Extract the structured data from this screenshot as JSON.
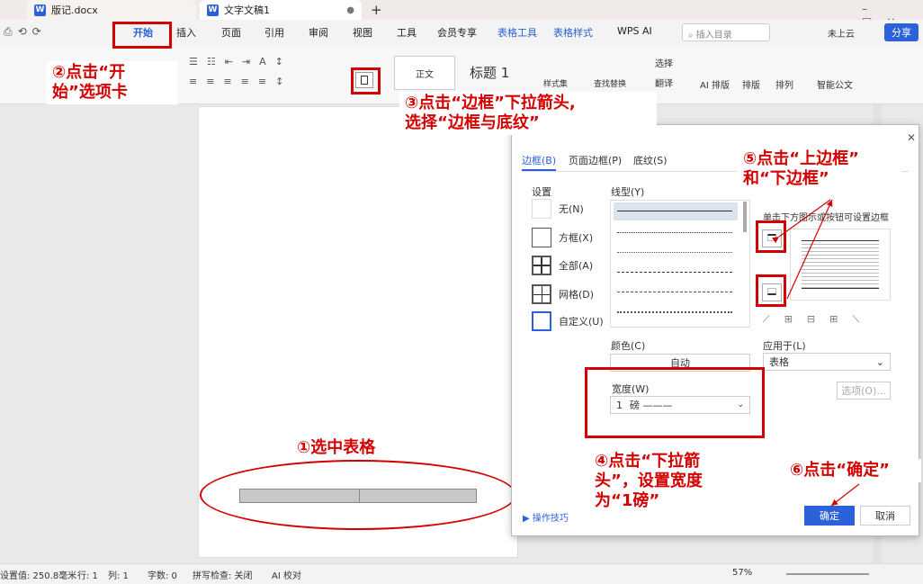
{
  "tabs": {
    "doc1": "版记.docx",
    "doc2": "文字文稿1",
    "new": "+"
  },
  "menu": {
    "items": [
      "开始",
      "插入",
      "页面",
      "引用",
      "审阅",
      "视图",
      "工具",
      "会员专享",
      "表格工具",
      "表格样式",
      "WPS AI"
    ],
    "search": "插入目录",
    "cloud": "未上云",
    "share": "分享"
  },
  "ribbon": {
    "style_normal": "正文",
    "style_heading": "标题 1",
    "select": "选择",
    "replace": "翻译",
    "ai_layout": "AI 排版",
    "layout": "排版",
    "arrange": "排列",
    "smart_doc": "智能公文",
    "style_set": "样式集",
    "find_replace": "查找替换"
  },
  "annotations": {
    "a1": "①选中表格",
    "a2_line1": "②点击“开",
    "a2_line2": "始”选项卡",
    "a3_line1": "③点击“边框”下拉箭头,",
    "a3_line2": "选择“边框与底纹”",
    "a4_line1": "④点击“下拉箭",
    "a4_line2": "头”，设置宽度",
    "a4_line3": "为“1磅”",
    "a5_line1": "⑤点击“上边框”",
    "a5_line2": "和“下边框”",
    "a6": "⑥点击“确定”"
  },
  "dialog": {
    "tab_border": "边框(B)",
    "tab_page_border": "页面边框(P)",
    "tab_shading": "底纹(S)",
    "settings_label": "设置",
    "settings": [
      "无(N)",
      "方框(X)",
      "全部(A)",
      "网格(D)",
      "自定义(U)"
    ],
    "line_style_label": "线型(Y)",
    "color_label": "颜色(C)",
    "color_value": "自动",
    "width_label": "宽度(W)",
    "width_value": "1",
    "width_unit": "磅 ———",
    "preview_hint": "单击下方图示或按钮可设置边框",
    "apply_label": "应用于(L)",
    "apply_value": "表格",
    "options": "选项(O)...",
    "tips": "操作技巧",
    "ok": "确定",
    "cancel": "取消"
  },
  "status": {
    "position": "设置值: 250.8毫米",
    "row": "行: 1",
    "col": "列: 1",
    "words": "字数: 0",
    "spell": "拼写检查: 关闭",
    "ai_check": "AI 校对",
    "zoom": "57%"
  },
  "colors": {
    "accent": "#2b62d9",
    "red": "#d40000"
  }
}
